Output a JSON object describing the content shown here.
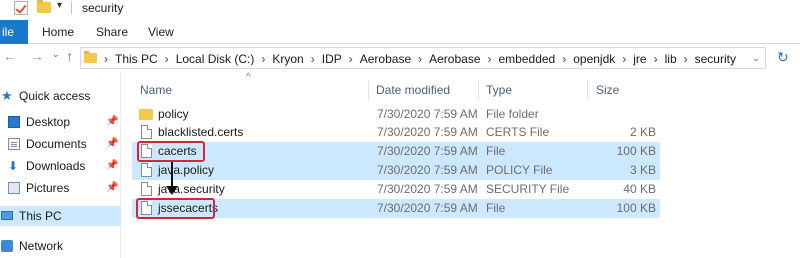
{
  "window": {
    "title": "security",
    "quick_access_dropdown": "▾"
  },
  "ribbon": {
    "tabs": [
      "ile",
      "Home",
      "Share",
      "View"
    ]
  },
  "address": {
    "back": "←",
    "forward": "→",
    "recent": "⌄",
    "up": "↑",
    "first_separator": "›",
    "crumbs": [
      "This PC",
      "Local Disk (C:)",
      "Kryon",
      "IDP",
      "Aerobase",
      "Aerobase",
      "embedded",
      "openjdk",
      "jre",
      "lib",
      "security"
    ],
    "separator": "›",
    "dropdown": "⌄",
    "refresh": "↻"
  },
  "navigation": {
    "items": [
      {
        "label": "Quick access",
        "icon": "star-icon",
        "pinned": false
      },
      {
        "label": "Desktop",
        "icon": "desktop-icon",
        "pinned": true
      },
      {
        "label": "Documents",
        "icon": "documents-icon",
        "pinned": true
      },
      {
        "label": "Downloads",
        "icon": "downloads-icon",
        "pinned": true
      },
      {
        "label": "Pictures",
        "icon": "pictures-icon",
        "pinned": true
      },
      {
        "label": "This PC",
        "icon": "computer-icon",
        "pinned": false,
        "selected": true
      },
      {
        "label": "Network",
        "icon": "network-icon",
        "pinned": false
      }
    ],
    "pin_glyph": "📌"
  },
  "file_list": {
    "sort_caret": "^",
    "columns": [
      "Name",
      "Date modified",
      "Type",
      "Size"
    ],
    "rows": [
      {
        "name": "policy",
        "date": "7/30/2020 7:59 AM",
        "type": "File folder",
        "size": "",
        "icon": "folder-icon",
        "selected": false
      },
      {
        "name": "blacklisted.certs",
        "date": "7/30/2020 7:59 AM",
        "type": "CERTS File",
        "size": "2 KB",
        "icon": "file-icon",
        "selected": false
      },
      {
        "name": "cacerts",
        "date": "7/30/2020 7:59 AM",
        "type": "File",
        "size": "100 KB",
        "icon": "file-icon",
        "selected": true,
        "highlighted": true
      },
      {
        "name": "java.policy",
        "date": "7/30/2020 7:59 AM",
        "type": "POLICY File",
        "size": "3 KB",
        "icon": "file-icon",
        "selected": true
      },
      {
        "name": "java.security",
        "date": "7/30/2020 7:59 AM",
        "type": "SECURITY File",
        "size": "40 KB",
        "icon": "file-icon",
        "selected": false
      },
      {
        "name": "jssecacerts",
        "date": "7/30/2020 7:59 AM",
        "type": "File",
        "size": "100 KB",
        "icon": "file-icon",
        "selected": true,
        "highlighted": true
      }
    ]
  },
  "colors": {
    "accent": "#1979ca",
    "selection": "#cce8ff",
    "highlight_box": "#d0283a"
  }
}
